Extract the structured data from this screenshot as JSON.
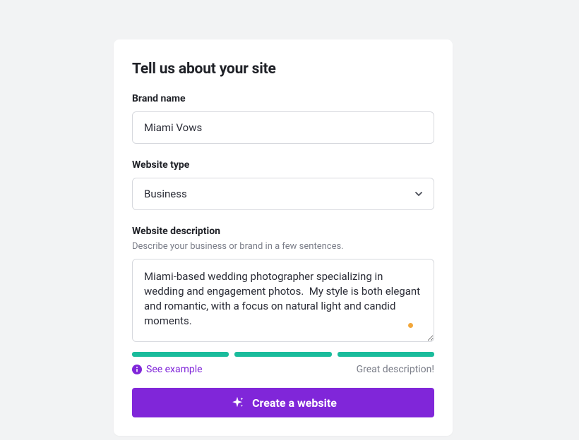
{
  "title": "Tell us about your site",
  "brand": {
    "label": "Brand name",
    "value": "Miami Vows"
  },
  "type": {
    "label": "Website type",
    "value": "Business"
  },
  "description": {
    "label": "Website description",
    "hint": "Describe your business or brand in a few sentences.",
    "value": "Miami-based wedding photographer specializing in wedding and engagement photos.  My style is both elegant and romantic, with a focus on natural light and candid moments."
  },
  "feedback": {
    "see_example": "See example",
    "status": "Great description!"
  },
  "cta": "Create a website"
}
